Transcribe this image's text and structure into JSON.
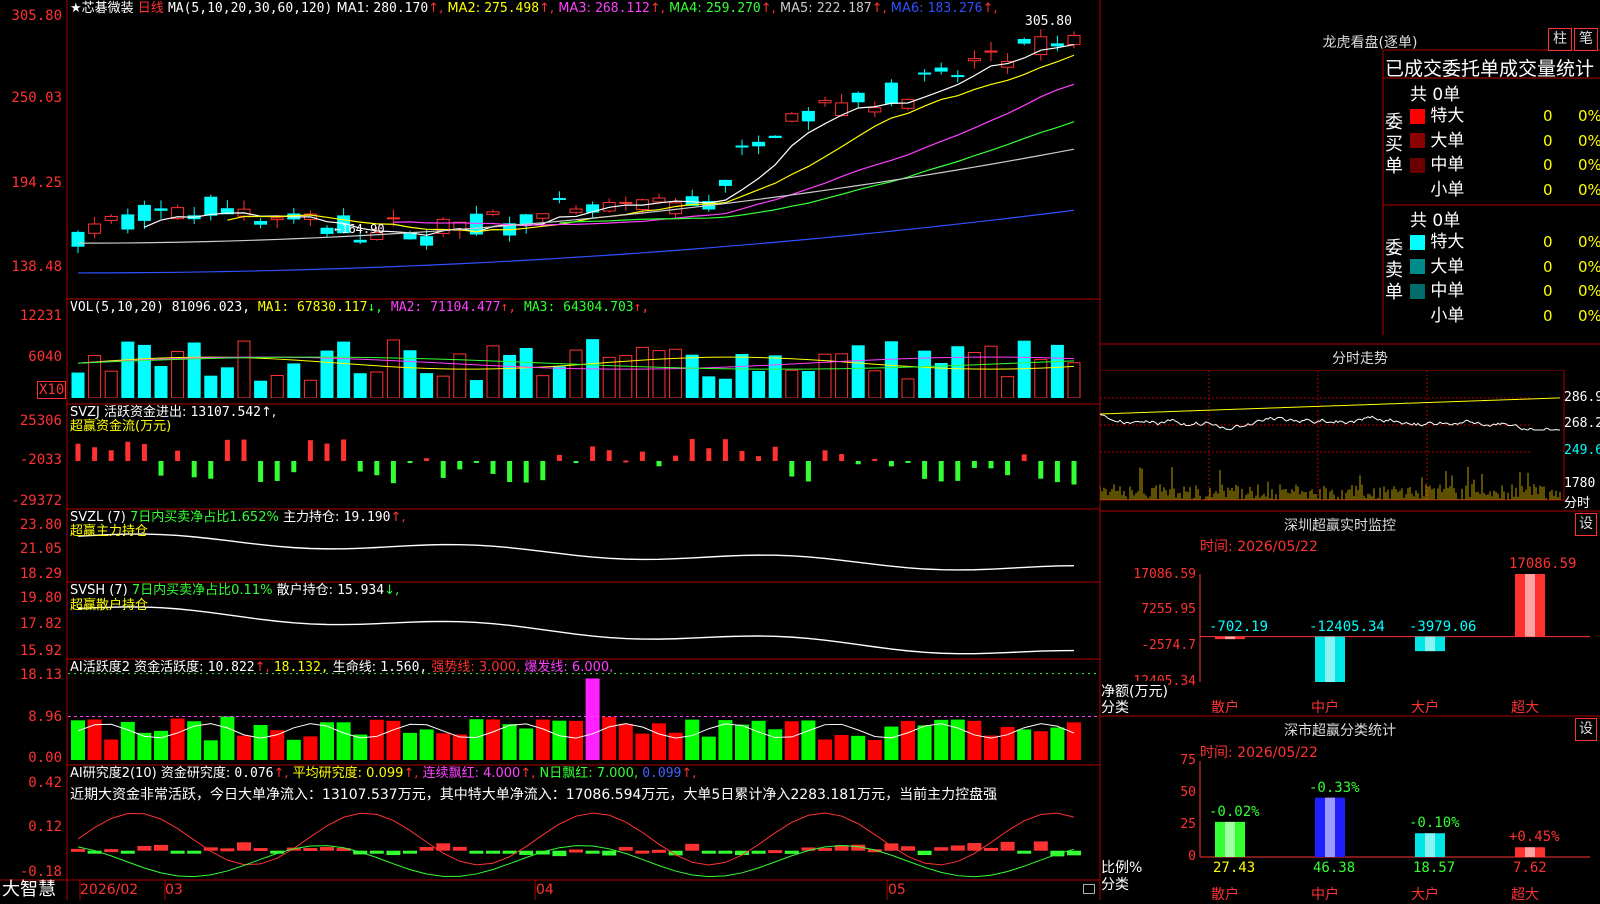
{
  "colors": {
    "up": "#ff3232",
    "down": "#00ffff",
    "grid": "#b00000",
    "bg": "#000000"
  },
  "main": {
    "title": "★芯碁微装",
    "period": "日线",
    "ma_label": "MA(5,10,20,30,60,120)",
    "ma_items": [
      {
        "name": "MA1",
        "value": "280.170",
        "arrow": "↑",
        "color": "#ffffff"
      },
      {
        "name": "MA2",
        "value": "275.498",
        "arrow": "↑",
        "color": "#ffff00"
      },
      {
        "name": "MA3",
        "value": "268.112",
        "arrow": "↑",
        "color": "#ff40ff"
      },
      {
        "name": "MA4",
        "value": "259.270",
        "arrow": "↑",
        "color": "#33ff33"
      },
      {
        "name": "MA5",
        "value": "222.187",
        "arrow": "↑",
        "color": "#cccccc"
      },
      {
        "name": "MA6",
        "value": "183.276",
        "arrow": "↑",
        "color": "#3050ff"
      }
    ],
    "y_ticks": [
      "305.80",
      "250.03",
      "194.25",
      "138.48"
    ],
    "high_mark": "305.80",
    "low_mark": "164.90",
    "ylim": [
      138.48,
      305.8
    ]
  },
  "vol": {
    "label": "VOL(5,10,20)",
    "value": "81096.023",
    "ma_items": [
      {
        "name": "MA1",
        "value": "67830.117",
        "arrow": "↓",
        "color": "#ffff00"
      },
      {
        "name": "MA2",
        "value": "71104.477",
        "arrow": "↑",
        "color": "#ff40ff"
      },
      {
        "name": "MA3",
        "value": "64304.703",
        "arrow": "↑",
        "color": "#33ff33"
      }
    ],
    "y_ticks": [
      "12231",
      "6040"
    ],
    "unit": "X10"
  },
  "svzj": {
    "label": "SVZJ  活跃资金进出:",
    "value": "13107.542",
    "arrow": "↑,",
    "subtitle": "超赢资金流(万元)",
    "y_ticks": [
      "25306",
      "-2033",
      "-29372"
    ]
  },
  "svzl": {
    "label": "SVZL (7)",
    "green_text": "7日内买卖净占比1.652%",
    "main_text": "主力持仓:",
    "value": "19.190",
    "arrow": "↑,",
    "subtitle": "超赢主力持仓",
    "y_ticks": [
      "23.80",
      "21.05",
      "18.29"
    ]
  },
  "svsh": {
    "label": "SVSH (7)",
    "green_text": "7日内买卖净占比0.11%",
    "main_text": "散户持仓:",
    "value": "15.934",
    "arrow": "↓,",
    "subtitle": "超赢散户持仓",
    "y_ticks": [
      "19.80",
      "17.82",
      "15.92"
    ]
  },
  "ai_active": {
    "label": "AI活跃度2",
    "text1": "资金活跃度:",
    "v1": "10.822",
    "a1": "↑,",
    "v2": "18.132,",
    "text3": "生命线:",
    "v3": "1.560,",
    "strong": "强势线: 3.000,",
    "burst": "爆发线: 6.000,",
    "y_ticks": [
      "18.13",
      "8.96",
      "0.00"
    ]
  },
  "ai_research": {
    "label": "AI研究度2(10)",
    "text1": "资金研究度:",
    "v1": "0.076",
    "a1": "↑,",
    "avg": "平均研究度: 0.099",
    "a2": "↑,",
    "cont": "连续飘红: 4.000",
    "a3": "↑,",
    "nday": "N日飘红: 7.000,",
    "v5": "0.099",
    "a5": "↑,",
    "desc": "近期大资金非常活跃，今日大单净流入：13107.537万元，其中特大单净流入：17086.594万元，大单5日累计净入2283.181万元，当前主力控盘强",
    "y_ticks": [
      "0.42",
      "0.12",
      "-0.18"
    ]
  },
  "footer": {
    "logo": "大智慧",
    "dates": [
      "2026/02",
      "03",
      "04",
      "05"
    ]
  },
  "dragon": {
    "title": "龙虎看盘(逐单)",
    "btn1": "柱",
    "btn2": "笔",
    "header": "已成交委托单成交量统计",
    "buy_label": "委买单",
    "sell_label": "委卖单",
    "buy_total": "共 0单",
    "sell_total": "共 0单",
    "buy_rows": [
      {
        "name": "特大",
        "count": "0",
        "pct": "0%",
        "color": "#ff0000"
      },
      {
        "name": "大单",
        "count": "0",
        "pct": "0%",
        "color": "#8b0000"
      },
      {
        "name": "中单",
        "count": "0",
        "pct": "0%",
        "color": "#6b0000"
      },
      {
        "name": "小单",
        "count": "0",
        "pct": "0%",
        "color": "#000000"
      }
    ],
    "sell_rows": [
      {
        "name": "特大",
        "count": "0",
        "pct": "0%",
        "color": "#00ffff"
      },
      {
        "name": "大单",
        "count": "0",
        "pct": "0%",
        "color": "#008b8b"
      },
      {
        "name": "中单",
        "count": "0",
        "pct": "0%",
        "color": "#006b6b"
      },
      {
        "name": "小单",
        "count": "0",
        "pct": "0%",
        "color": "#000000"
      }
    ]
  },
  "intraday": {
    "title": "分时走势",
    "y_ticks": [
      "286.9",
      "268.2",
      "249.6"
    ],
    "vol_label": "1780",
    "vol_unit": "分时"
  },
  "sz_monitor": {
    "title": "深圳超赢实时监控",
    "btn": "设",
    "time": "时间: 2026/05/22",
    "y_ticks": [
      "17086.59",
      "7255.95",
      "-2574.7",
      "-12405.34"
    ],
    "ylabel": "净额(万元)",
    "xlabel": "分类",
    "categories": [
      "散户",
      "中户",
      "大户",
      "超大"
    ],
    "values_text": [
      "-702.19",
      "-12405.34",
      "-3979.06",
      "17086.59"
    ]
  },
  "sz_class": {
    "title": "深市超赢分类统计",
    "btn": "设",
    "time": "时间: 2026/05/22",
    "y_ticks": [
      "75",
      "50",
      "25",
      "0"
    ],
    "ylabel": "比例%",
    "xlabel": "分类",
    "categories": [
      "散户",
      "中户",
      "大户",
      "超大"
    ],
    "values_text": [
      "27.43",
      "46.38",
      "18.57",
      "7.62"
    ],
    "changes": [
      "-0.02%",
      "-0.33%",
      "-0.10%",
      "+0.45%"
    ]
  },
  "chart_data": [
    {
      "type": "bar",
      "title": "深圳超赢实时监控",
      "ylabel": "净额(万元)",
      "categories": [
        "散户",
        "中户",
        "大户",
        "超大"
      ],
      "values": [
        -702.19,
        -12405.34,
        -3979.06,
        17086.59
      ],
      "ylim": [
        -12405.34,
        17086.59
      ]
    },
    {
      "type": "bar",
      "title": "深市超赢分类统计",
      "ylabel": "比例%",
      "categories": [
        "散户",
        "中户",
        "大户",
        "超大"
      ],
      "values": [
        27.43,
        46.38,
        18.57,
        7.62
      ],
      "ylim": [
        0,
        75
      ]
    }
  ]
}
